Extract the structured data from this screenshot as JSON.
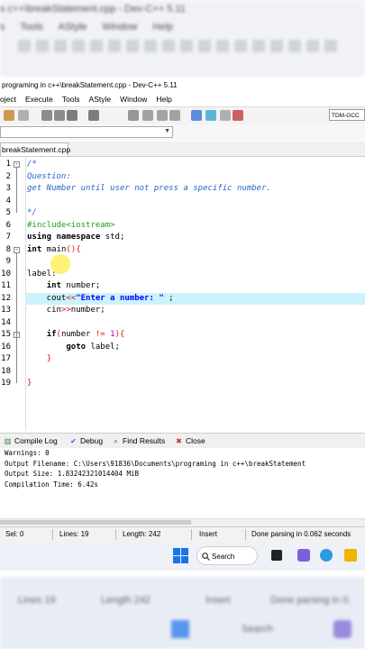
{
  "ghost_top": {
    "title": "s c++\\breakStatement.cpp - Dev-C++ 5.11",
    "menu": "s  Tools  AStyle  Window  Help"
  },
  "window_title": "programing in c++\\breakStatement.cpp - Dev-C++ 5.11",
  "menu": [
    "oject",
    "Execute",
    "Tools",
    "AStyle",
    "Window",
    "Help"
  ],
  "toolbar": {
    "compiler": "TDM-GCC",
    "icons": [
      "undo-icon",
      "redo-icon",
      "search-icon",
      "replace-icon",
      "indent-icon",
      "unindent-icon",
      "bookmark-icon",
      "compile-icon",
      "run-icon",
      "compile-run-icon",
      "rebuild-icon",
      "check-icon",
      "stop-icon",
      "debug-icon"
    ]
  },
  "file_tab": "breakStatement.cpp",
  "editor": {
    "lines": [
      {
        "n": "1",
        "fold": "-",
        "segs": [
          [
            "c-com",
            "/*"
          ]
        ]
      },
      {
        "n": "2",
        "segs": [
          [
            "c-com",
            "Question:"
          ]
        ]
      },
      {
        "n": "3",
        "segs": [
          [
            "c-com",
            "get Number until user not press a specific number."
          ]
        ]
      },
      {
        "n": "4",
        "segs": [
          [
            "c-com",
            ""
          ]
        ]
      },
      {
        "n": "5",
        "segs": [
          [
            "c-com",
            "*/"
          ]
        ]
      },
      {
        "n": "6",
        "segs": [
          [
            "c-pp",
            "#include<iostream>"
          ]
        ]
      },
      {
        "n": "7",
        "segs": [
          [
            "c-kw",
            "using namespace"
          ],
          [
            "",
            " std;"
          ]
        ]
      },
      {
        "n": "8",
        "fold": "-",
        "segs": [
          [
            "c-kw",
            "int"
          ],
          [
            "",
            " main"
          ],
          [
            "c-op",
            "(){"
          ]
        ]
      },
      {
        "n": "9",
        "segs": [
          [
            "",
            ""
          ]
        ]
      },
      {
        "n": "10",
        "segs": [
          [
            "",
            "label:"
          ]
        ]
      },
      {
        "n": "11",
        "segs": [
          [
            "",
            "    "
          ],
          [
            "c-kw",
            "int"
          ],
          [
            "",
            " number;"
          ]
        ]
      },
      {
        "n": "12",
        "hl": true,
        "segs": [
          [
            "",
            "    cout"
          ],
          [
            "c-op",
            "<<"
          ],
          [
            "c-str",
            "\"Enter a number: \""
          ],
          [
            "",
            " ;"
          ]
        ]
      },
      {
        "n": "13",
        "segs": [
          [
            "",
            "    cin"
          ],
          [
            "c-op",
            ">>"
          ],
          [
            "",
            "number;"
          ]
        ]
      },
      {
        "n": "14",
        "segs": [
          [
            "",
            ""
          ]
        ]
      },
      {
        "n": "15",
        "fold": "-",
        "segs": [
          [
            "",
            "    "
          ],
          [
            "c-kw",
            "if"
          ],
          [
            "c-op",
            "("
          ],
          [
            "",
            "number "
          ],
          [
            "c-op",
            "!="
          ],
          [
            "",
            " "
          ],
          [
            "c-num",
            "1"
          ],
          [
            "c-op",
            "){"
          ]
        ]
      },
      {
        "n": "16",
        "segs": [
          [
            "",
            "        "
          ],
          [
            "c-kw",
            "goto"
          ],
          [
            "",
            " label;"
          ]
        ]
      },
      {
        "n": "17",
        "segs": [
          [
            "",
            "    "
          ],
          [
            "c-op",
            "}"
          ]
        ]
      },
      {
        "n": "18",
        "segs": [
          [
            "",
            ""
          ]
        ]
      },
      {
        "n": "19",
        "segs": [
          [
            "c-op",
            "}"
          ]
        ]
      }
    ]
  },
  "panel_tabs": [
    {
      "icon": "compile-log-icon",
      "label": "Compile Log"
    },
    {
      "icon": "debug-icon",
      "label": "Debug"
    },
    {
      "icon": "find-results-icon",
      "label": "Find Results"
    },
    {
      "icon": "close-icon",
      "label": "Close"
    }
  ],
  "compile_log": [
    "Warnings: 0",
    "Output Filename: C:\\Users\\91836\\Documents\\programing in c++\\breakStatement",
    "Output Size: 1.83242321014404 MiB",
    "Compilation Time: 6.42s"
  ],
  "status": {
    "sel": "Sel:  0",
    "lines": "Lines:  19",
    "length": "Length:  242",
    "mode": "Insert",
    "parse": "Done parsing in 0.062 seconds"
  },
  "taskbar": {
    "search": "Search"
  },
  "ghost_bottom": {
    "lines": "Lines  19",
    "length": "Length  242",
    "mode": "Insert",
    "parse": "Done parsing in 0.",
    "search": "Search"
  },
  "colors": {
    "highlight_line": "#ccf2fc",
    "comment": "#2266cc",
    "preprocessor": "#229922",
    "string": "#0000ff",
    "operator": "#e01010"
  }
}
